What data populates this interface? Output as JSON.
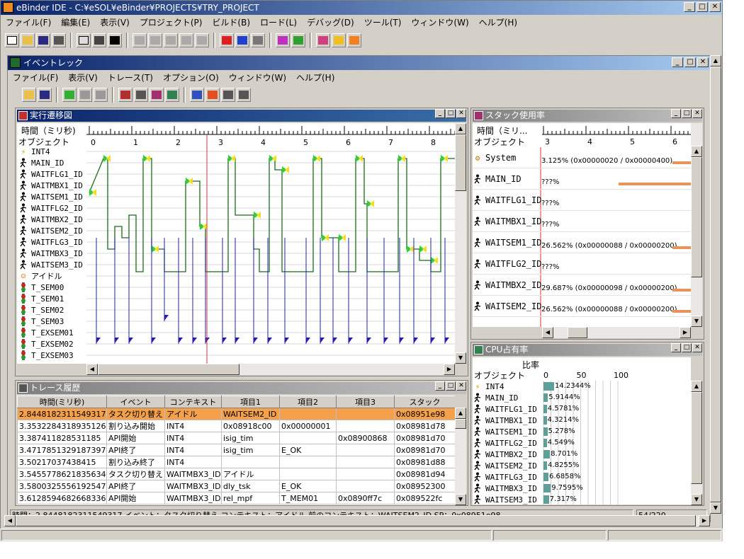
{
  "app": {
    "title": "eBinder IDE - C:¥eSOL¥eBinder¥PROJECTS¥TRY_PROJECT",
    "menu": [
      "ファイル(F)",
      "編集(E)",
      "表示(V)",
      "プロジェクト(P)",
      "ビルド(B)",
      "ロード(L)",
      "デバッグ(D)",
      "ツール(T)",
      "ウィンドウ(W)",
      "ヘルプ(H)"
    ]
  },
  "event_track": {
    "title": "イベントレック",
    "menu": [
      "ファイル(F)",
      "表示(V)",
      "トレース(T)",
      "オプション(O)",
      "ウィンドウ(W)",
      "ヘルプ(H)"
    ]
  },
  "exec_panel": {
    "title": "実行遷移図",
    "time_label": "時間（ミリ秒)",
    "object_label": "オブジェクト",
    "ticks": [
      "0",
      "1",
      "2",
      "3",
      "4",
      "5",
      "6",
      "7",
      "8"
    ],
    "objects": [
      {
        "name": "INT4",
        "icon": "interrupt-icon"
      },
      {
        "name": "MAIN_ID",
        "icon": "task-icon"
      },
      {
        "name": "WAITFLG1_ID",
        "icon": "task-icon"
      },
      {
        "name": "WAITMBX1_ID",
        "icon": "task-icon"
      },
      {
        "name": "WAITSEM1_ID",
        "icon": "task-icon"
      },
      {
        "name": "WAITFLG2_ID",
        "icon": "task-icon"
      },
      {
        "name": "WAITMBX2_ID",
        "icon": "task-icon"
      },
      {
        "name": "WAITSEM2_ID",
        "icon": "task-icon"
      },
      {
        "name": "WAITFLG3_ID",
        "icon": "task-icon"
      },
      {
        "name": "WAITMBX3_ID",
        "icon": "task-icon"
      },
      {
        "name": "WAITSEM3_ID",
        "icon": "task-icon"
      },
      {
        "name": "アイドル",
        "icon": "idle-icon"
      },
      {
        "name": "T_SEM00",
        "icon": "semaphore-icon"
      },
      {
        "name": "T_SEM01",
        "icon": "semaphore-icon"
      },
      {
        "name": "T_SEM02",
        "icon": "semaphore-icon"
      },
      {
        "name": "T_SEM03",
        "icon": "semaphore-icon"
      },
      {
        "name": "T_EXSEM01",
        "icon": "semaphore-icon"
      },
      {
        "name": "T_EXSEM02",
        "icon": "semaphore-icon"
      },
      {
        "name": "T_EXSEM03",
        "icon": "semaphore-icon"
      }
    ]
  },
  "stack_panel": {
    "title": "スタック使用率",
    "time_label": "時間（ミリ...",
    "object_label": "オブジェクト",
    "ticks": [
      "3",
      "4",
      "5",
      "6"
    ],
    "rows": [
      {
        "name": "System",
        "value": "3.125% (0x00000020 / 0x00000400)",
        "icon": "system-icon"
      },
      {
        "name": "MAIN_ID",
        "value": "???%",
        "icon": "task-icon"
      },
      {
        "name": "WAITFLG1_ID",
        "value": "???%",
        "icon": "task-icon"
      },
      {
        "name": "WAITMBX1_ID",
        "value": "???%",
        "icon": "task-icon"
      },
      {
        "name": "WAITSEM1_ID",
        "value": "26.562% (0x00000088 / 0x00000200)",
        "icon": "task-icon"
      },
      {
        "name": "WAITFLG2_ID",
        "value": "???%",
        "icon": "task-icon"
      },
      {
        "name": "WAITMBX2_ID",
        "value": "29.687% (0x00000098 / 0x00000200)",
        "icon": "task-icon"
      },
      {
        "name": "WAITSEM2_ID",
        "value": "26.562% (0x00000088 / 0x00000200)",
        "icon": "task-icon"
      }
    ]
  },
  "cpu_panel": {
    "title": "CPU占有率",
    "ratio_label": "比率",
    "object_label": "オブジェクト",
    "ticks": [
      "0",
      "50",
      "100"
    ],
    "rows": [
      {
        "name": "INT4",
        "value": "14.2344%",
        "pct": 14.2344,
        "icon": "interrupt-icon"
      },
      {
        "name": "MAIN_ID",
        "value": "5.9144%",
        "pct": 5.9144,
        "icon": "task-icon"
      },
      {
        "name": "WAITFLG1_ID",
        "value": "4.5781%",
        "pct": 4.5781,
        "icon": "task-icon"
      },
      {
        "name": "WAITMBX1_ID",
        "value": "4.3214%",
        "pct": 4.3214,
        "icon": "task-icon"
      },
      {
        "name": "WAITSEM1_ID",
        "value": "5.278%",
        "pct": 5.278,
        "icon": "task-icon"
      },
      {
        "name": "WAITFLG2_ID",
        "value": "4.549%",
        "pct": 4.549,
        "icon": "task-icon"
      },
      {
        "name": "WAITMBX2_ID",
        "value": "8.701%",
        "pct": 8.701,
        "icon": "task-icon"
      },
      {
        "name": "WAITSEM2_ID",
        "value": "4.8255%",
        "pct": 4.8255,
        "icon": "task-icon"
      },
      {
        "name": "WAITFLG3_ID",
        "value": "6.6858%",
        "pct": 6.6858,
        "icon": "task-icon"
      },
      {
        "name": "WAITMBX3_ID",
        "value": "9.7595%",
        "pct": 9.7595,
        "icon": "task-icon"
      },
      {
        "name": "WAITSEM3_ID",
        "value": "7.317%",
        "pct": 7.317,
        "icon": "task-icon"
      }
    ]
  },
  "trace_panel": {
    "title": "トレース履歴",
    "columns": [
      "時間(ミリ秒)",
      "イベント",
      "コンテキスト",
      "項目1",
      "項目2",
      "項目3",
      "スタック"
    ],
    "rows": [
      [
        "2.8448182311549317",
        "タスク切り替え",
        "アイドル",
        "WAITSEM2_ID",
        "",
        "",
        "0x08951e98"
      ],
      [
        "3.3532284318935126",
        "割り込み開始",
        "INT4",
        "0x08918c00",
        "0x00000001",
        "",
        "0x08981d78"
      ],
      [
        "3.387411828531185",
        "API開始",
        "INT4",
        "isig_tim",
        "",
        "0x08900868",
        "0x08981d70"
      ],
      [
        "3.4717851329187397",
        "API終了",
        "INT4",
        "isig_tim",
        "E_OK",
        "",
        "0x08981d70"
      ],
      [
        "3.50217037438415",
        "割り込み終了",
        "INT4",
        "",
        "",
        "",
        "0x08981d88"
      ],
      [
        "3.5455778621835634",
        "タスク切り替え",
        "WAITMBX3_ID",
        "アイドル",
        "",
        "",
        "0x08981d94"
      ],
      [
        "3.5800325556192547",
        "API終了",
        "WAITMBX3_ID",
        "dly_tsk",
        "E_OK",
        "",
        "0x08952300"
      ],
      [
        "3.6128594682668336",
        "API開始",
        "WAITMBX3_ID",
        "rel_mpf",
        "T_MEM01",
        "0x0890ff7c",
        "0x089522fc"
      ]
    ]
  },
  "status": {
    "main": "時間：2.8448182311549317 イベント：タスク切り替え コンテキスト：アイドル 前のコンテキスト：WAITSEM2_ID SP：0x08951e98",
    "count": "54/220"
  },
  "colors": {
    "title_active": "#0a246a",
    "signal": "#1a6b1a",
    "event": "#1f1fb4",
    "marker": "#e03030",
    "selection": "#f5a04a",
    "stack_bar": "#e8935a",
    "cpu_bar": "#5f9f9a"
  }
}
